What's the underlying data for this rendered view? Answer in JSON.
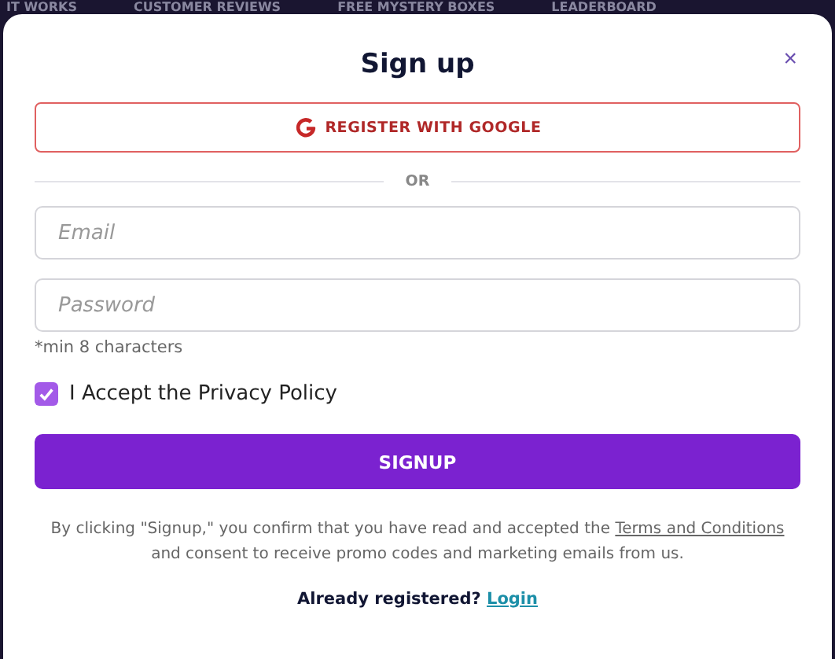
{
  "background_nav": [
    "IT WORKS",
    "CUSTOMER REVIEWS",
    "FREE MYSTERY BOXES",
    "LEADERBOARD"
  ],
  "dialog": {
    "title": "Sign up",
    "close": "×",
    "google_button": {
      "label": "REGISTER WITH GOOGLE"
    },
    "divider": "OR",
    "fields": [
      {
        "placeholder": "Email"
      },
      {
        "placeholder": "Password"
      }
    ],
    "password_hint": "*min 8 characters",
    "privacy": {
      "label": "I Accept the Privacy Policy",
      "checked": true
    },
    "submit": "SIGNUP",
    "disclaimer": {
      "before": "By clicking \"Signup,\" you confirm that you have read and accepted the",
      "link": "Terms and Conditions",
      "after": "and consent to receive promo codes and marketing emails from us."
    },
    "login": {
      "prompt": "Already registered?",
      "link": "Login"
    }
  }
}
